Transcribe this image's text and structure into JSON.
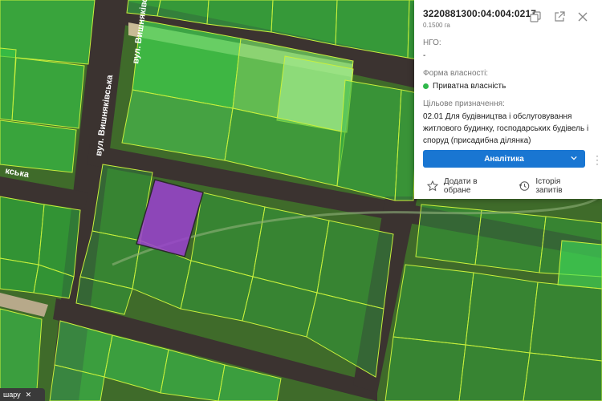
{
  "map": {
    "street_label_1": "вул. Вишняківська",
    "street_label_2": "вул. Вишняківська",
    "street_label_3": "кська",
    "layer_button": "шару",
    "parcel_fill": "#9b3fd1",
    "parcel_outline": "#c8f03c"
  },
  "panel": {
    "cadastral_number": "3220881300:04:004:0217",
    "area": "0.1500 га",
    "ngo_label": "НГО:",
    "ngo_value": "-",
    "ownership_label": "Форма власності:",
    "ownership_value": "Приватна власність",
    "purpose_label": "Цільове призначення:",
    "purpose_value": "02.01 Для будівництва і обслуговування житлового будинку, господарських будівель і споруд (присадибна ділянка)",
    "analytics_button": "Аналітика",
    "add_favorite": "Додати в обране",
    "request_history": "Історія запитів",
    "status_color": "#2fb84b",
    "accent_color": "#1976d2"
  }
}
